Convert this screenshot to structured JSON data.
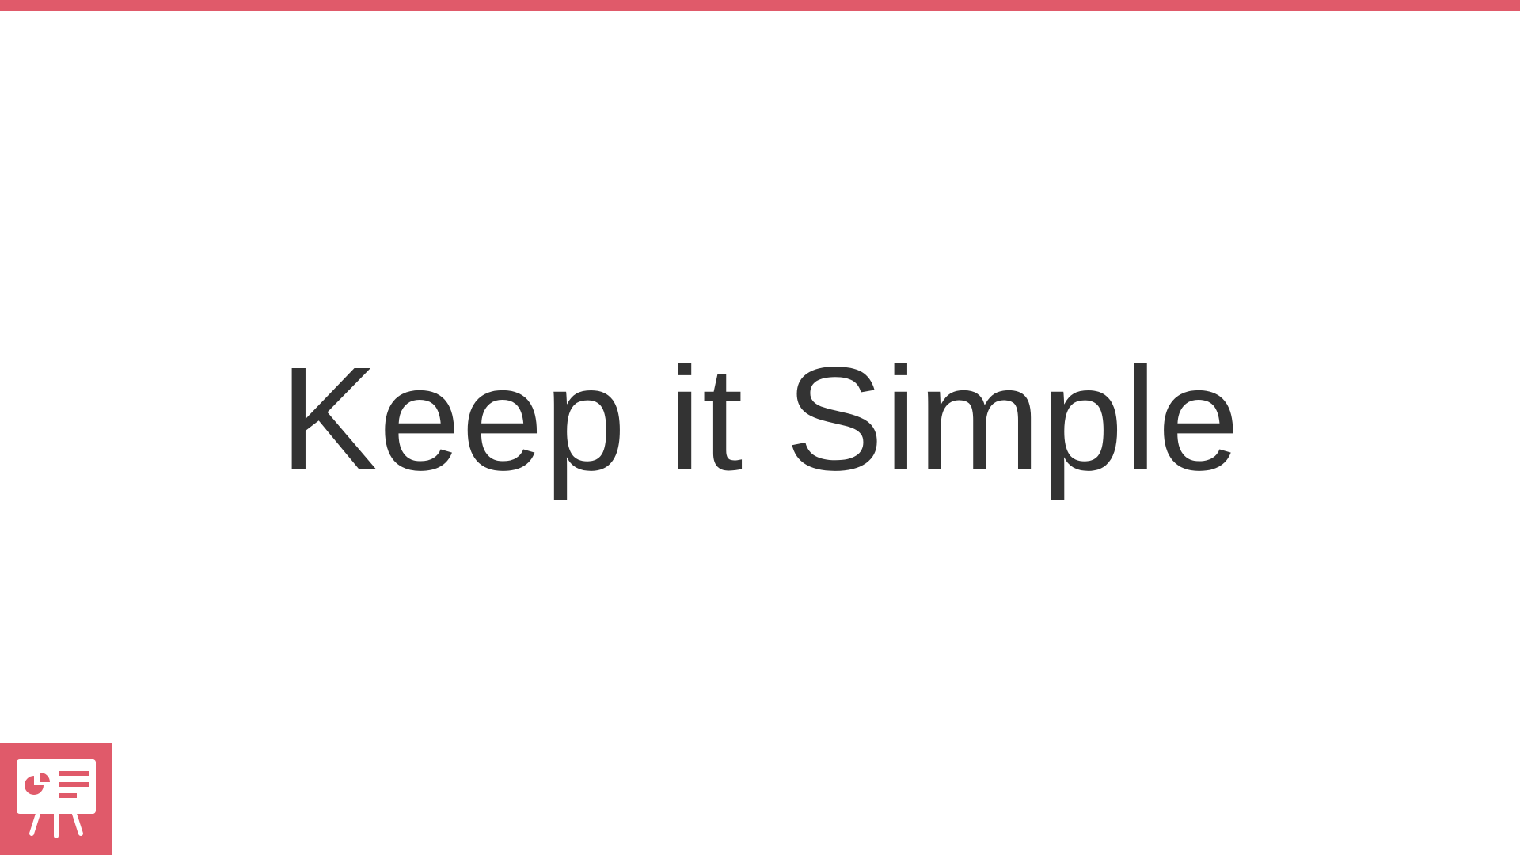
{
  "slide": {
    "title": "Keep it Simple",
    "accent_color": "#e05a6a",
    "text_color": "#333333",
    "background_color": "#ffffff"
  },
  "logo": {
    "icon": "presentation-board-icon"
  }
}
